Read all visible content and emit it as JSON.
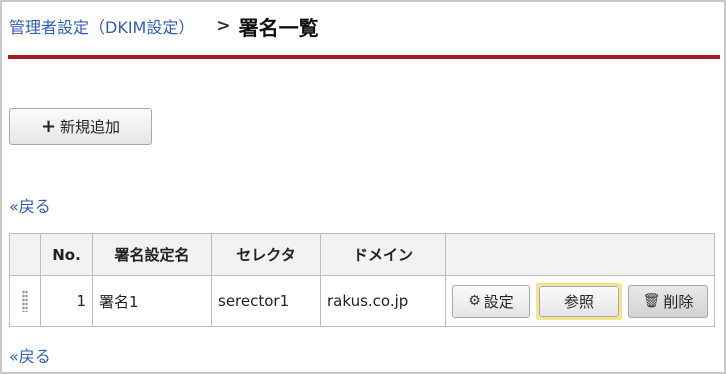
{
  "breadcrumb": {
    "parent_label": "管理者設定（DKIM設定）",
    "separator": ">",
    "current": "署名一覧"
  },
  "toolbar": {
    "add_icon": "plus-icon",
    "add_label": "新規追加"
  },
  "back_link_label": "«戻る",
  "table": {
    "headers": [
      "No.",
      "署名設定名",
      "セレクタ",
      "ドメイン"
    ],
    "rows": [
      {
        "no": "1",
        "name": "署名1",
        "selector": "serector1",
        "domain": "rakus.co.jp",
        "setting_label": "設定",
        "view_label": "参照",
        "delete_label": "削除"
      }
    ]
  },
  "colors": {
    "link": "#2f5fb3",
    "header_rule": "#a01e23",
    "highlight": "#f3e68a"
  }
}
